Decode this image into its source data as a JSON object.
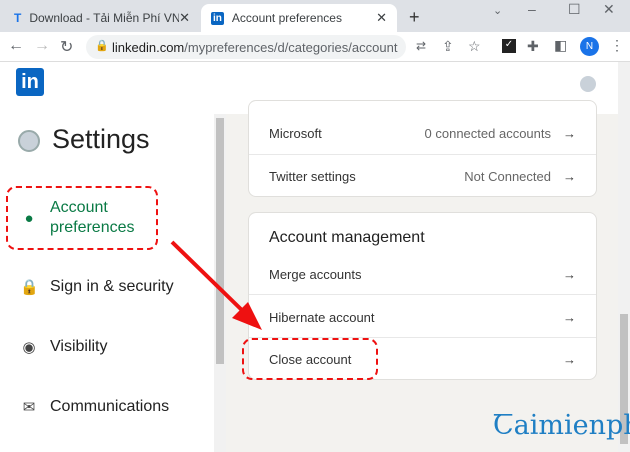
{
  "browser": {
    "tabs": [
      {
        "icon": "T",
        "title": "Download - Tải Miễn Phí VN - Ph"
      },
      {
        "icon": "in",
        "title": "Account preferences"
      }
    ],
    "url_domain": "linkedin.com",
    "url_path": "/mypreferences/d/categories/account",
    "profile_initial": "N"
  },
  "header": {
    "logo": "in"
  },
  "sidebar": {
    "title": "Settings",
    "items": [
      {
        "label": "Account preferences",
        "icon": "person-icon"
      },
      {
        "label": "Sign in & security",
        "icon": "lock-icon"
      },
      {
        "label": "Visibility",
        "icon": "eye-icon"
      },
      {
        "label": "Communications",
        "icon": "mail-icon"
      }
    ]
  },
  "partners": [
    {
      "label": "Microsoft",
      "value": "0 connected accounts"
    },
    {
      "label": "Twitter settings",
      "value": "Not Connected"
    }
  ],
  "account_management": {
    "title": "Account management",
    "items": [
      "Merge accounts",
      "Hibernate account",
      "Close account"
    ]
  },
  "watermark": "Taimienphi.vn",
  "colors": {
    "accent": "#0a66c2",
    "annotation": "#e11111"
  }
}
